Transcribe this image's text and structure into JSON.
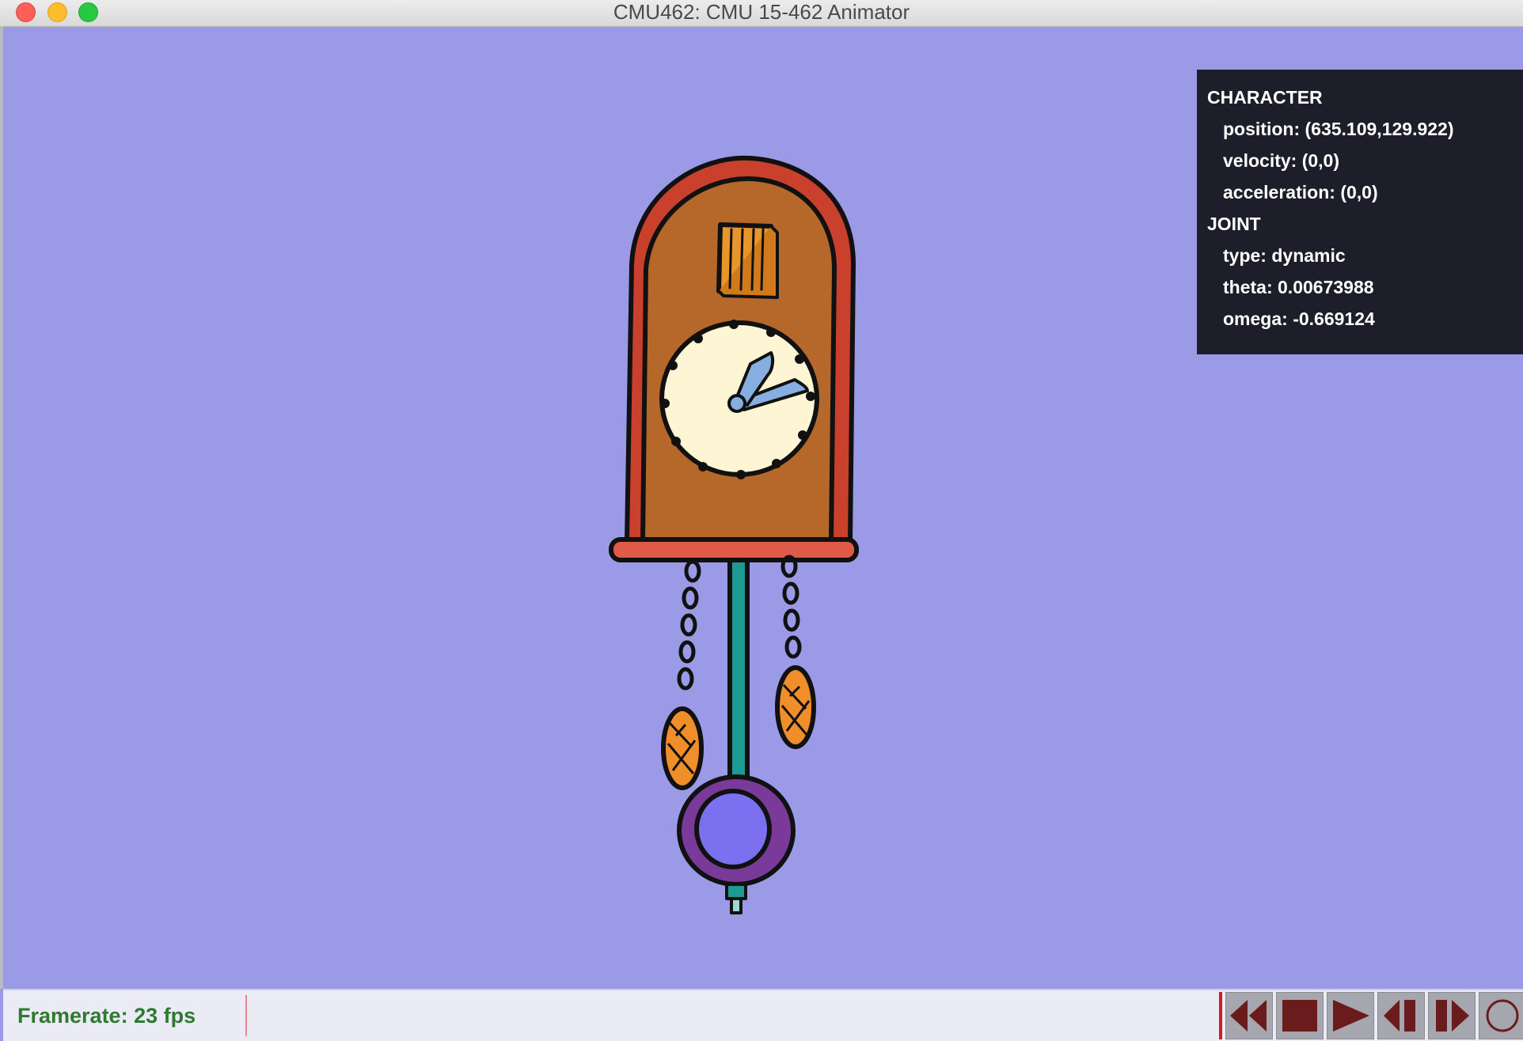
{
  "window": {
    "title": "CMU462: CMU 15-462 Animator"
  },
  "colors": {
    "background": "#9a9ae6",
    "panel": "#1e1e2a",
    "framerate_text": "#2e7a2e",
    "clock_frame": "#c9402c",
    "clock_body": "#b5682a",
    "clock_face": "#fdf5d3",
    "hands": "#86aee0",
    "pendulum_rod": "#1e9a94",
    "pendulum_bob_outer": "#7a3a9a",
    "pendulum_bob_inner": "#7a70f0",
    "weights": "#f08f2a",
    "transport_icon": "#6a1c1c"
  },
  "info_panel": {
    "character_heading": "CHARACTER",
    "position_label": "position",
    "position_value": "(635.109,129.922)",
    "velocity_label": "velocity",
    "velocity_value": "(0,0)",
    "acceleration_label": "acceleration",
    "acceleration_value": "(0,0)",
    "joint_heading": "JOINT",
    "type_label": "type",
    "type_value": "dynamic",
    "theta_label": "theta",
    "theta_value": "0.00673988",
    "omega_label": "omega",
    "omega_value": "-0.669124"
  },
  "status": {
    "framerate": "Framerate: 23 fps"
  },
  "transport": {
    "buttons": [
      "rewind-icon",
      "stop-icon",
      "play-icon",
      "step-back-icon",
      "step-forward-icon",
      "record-icon"
    ]
  }
}
